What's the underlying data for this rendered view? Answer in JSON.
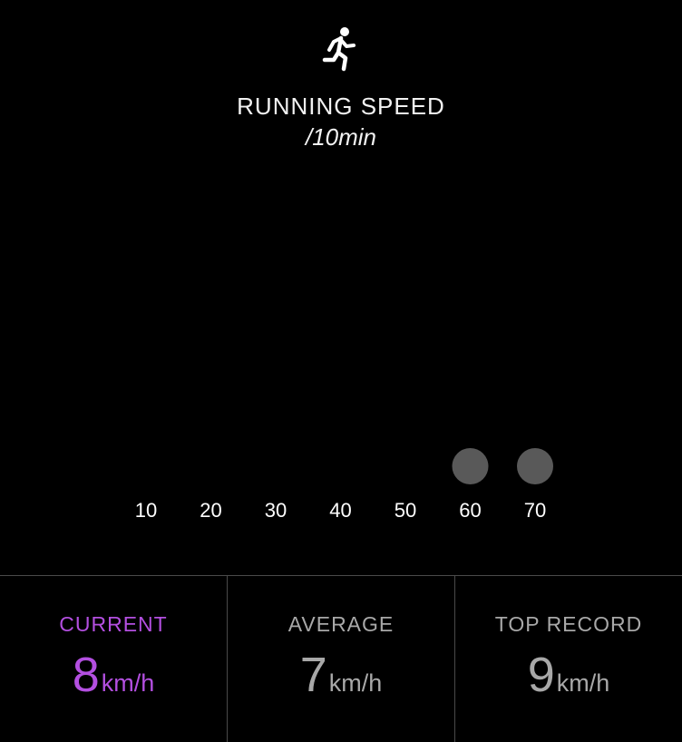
{
  "header": {
    "icon": "running-person-icon",
    "title": "RUNNING SPEED",
    "subtitle": "/10min"
  },
  "chart_data": {
    "type": "scatter",
    "categories": [
      "10",
      "20",
      "30",
      "40",
      "50",
      "60",
      "70"
    ],
    "points_present": [
      "60",
      "70"
    ],
    "point_color": "#595959"
  },
  "stats": {
    "current": {
      "label": "CURRENT",
      "value": "8",
      "unit": "km/h"
    },
    "average": {
      "label": "AVERAGE",
      "value": "7",
      "unit": "km/h"
    },
    "top_record": {
      "label": "TOP RECORD",
      "value": "9",
      "unit": "km/h"
    }
  },
  "colors": {
    "accent": "#b34fe0",
    "muted": "#a8a8a8",
    "background": "#000000"
  }
}
